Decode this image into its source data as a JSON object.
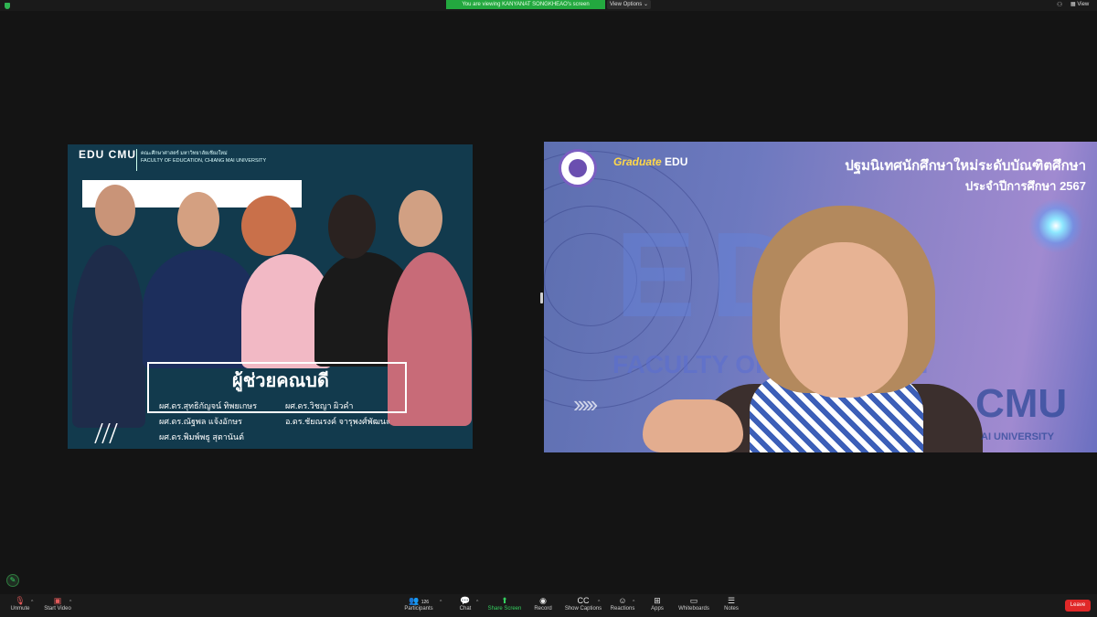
{
  "topbar": {
    "banner_text": "You are viewing KANYANAT SONGKHEAO's screen",
    "view_options": "View Options ⌄",
    "view_label": "View"
  },
  "shared_screen": {
    "logo": "EDU CMU",
    "faculty_th": "คณะศึกษาศาสตร์ มหาวิทยาลัยเชียงใหม่",
    "faculty_en": "FACULTY OF EDUCATION, CHIANG MAI UNIVERSITY",
    "title": "ผู้ช่วยคณบดี",
    "names": [
      "ผศ.ดร.สุทธิกัญจน์ ทิพยเกษร",
      "ผศ.ดร.ณัฐพล แจ้งอักษร",
      "ผศ.ดร.พิมพ์พธู สุตานันต์",
      "ผศ.ดร.วิชญา ผิวคำ",
      "อ.ดร.ชัยณรงค์ จารุพงศ์พัฒนะ"
    ]
  },
  "video": {
    "title_line1": "ปฐมนิเทศนักศึกษาใหม่ระดับบัณฑิตศึกษา",
    "title_line2": "ประจำปีการศึกษา 2567",
    "logo_graduate": "Graduate",
    "logo_edu": "EDU",
    "bg_big": "EDU",
    "bg_faculty": "FACULTY OF EDUCATION",
    "bg_cmu": "CMU",
    "bg_univ": "AI UNIVERSITY"
  },
  "toolbar": {
    "unmute": "Unmute",
    "start_video": "Start Video",
    "participants_count": "126",
    "participants": "Participants",
    "chat": "Chat",
    "share_screen": "Share Screen",
    "record": "Record",
    "show_captions": "Show Captions",
    "reactions": "Reactions",
    "apps": "Apps",
    "whiteboards": "Whiteboards",
    "notes": "Notes",
    "leave": "Leave"
  },
  "colors": {
    "share_green": "#23a83f",
    "leave_red": "#e02828",
    "slide_bg": "#123a4d"
  }
}
